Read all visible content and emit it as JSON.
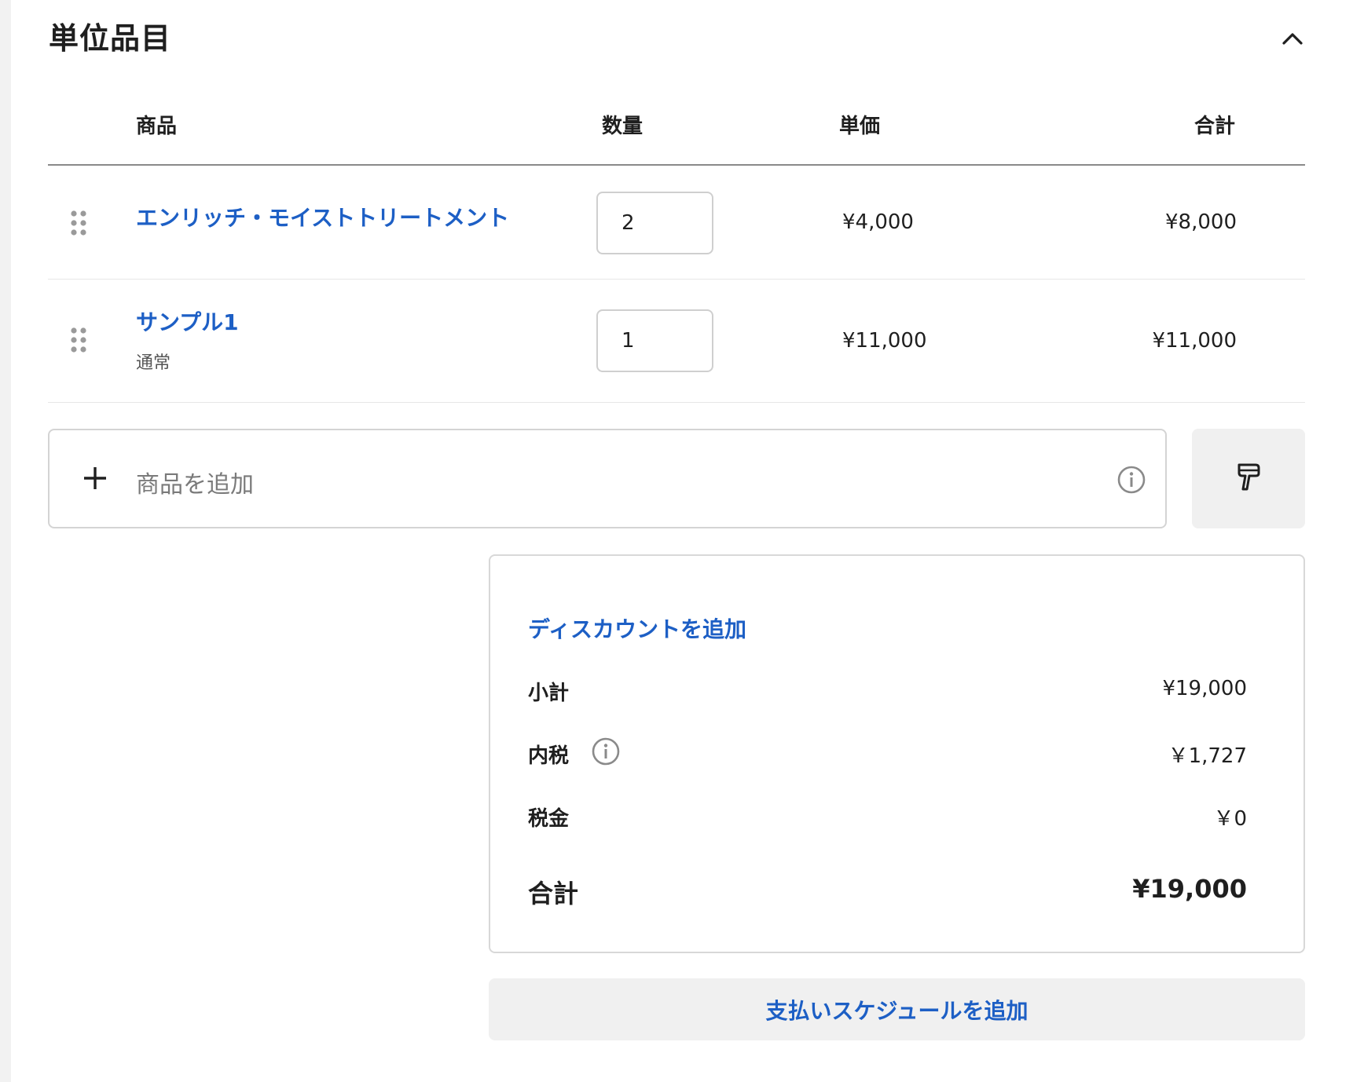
{
  "section": {
    "title": "単位品目",
    "collapse_icon": "chevron-up-icon"
  },
  "table": {
    "headers": {
      "product": "商品",
      "quantity": "数量",
      "unit_price": "単価",
      "total": "合計"
    },
    "rows": [
      {
        "name": "エンリッチ・モイストトリートメント",
        "variant": "",
        "quantity": "2",
        "unit_price": "¥4,000",
        "total": "¥8,000"
      },
      {
        "name": "サンプル1",
        "variant": "通常",
        "quantity": "1",
        "unit_price": "¥11,000",
        "total": "¥11,000"
      }
    ]
  },
  "add_product": {
    "placeholder": "商品を追加",
    "plus_icon": "plus-icon",
    "info_icon": "info-icon",
    "brush_icon": "paint-brush-icon"
  },
  "summary": {
    "discount_link": "ディスカウントを追加",
    "subtotal_label": "小計",
    "subtotal_value": "¥19,000",
    "included_tax_label": "内税",
    "included_tax_value": "￥1,727",
    "tax_label": "税金",
    "tax_value": "￥0",
    "total_label": "合計",
    "total_value": "¥19,000"
  },
  "schedule_button": "支払いスケジュールを追加",
  "colors": {
    "link_blue": "#1d5fc5",
    "background": "#f2f2f2",
    "card": "#ffffff",
    "button_gray": "#f0f0f0"
  }
}
